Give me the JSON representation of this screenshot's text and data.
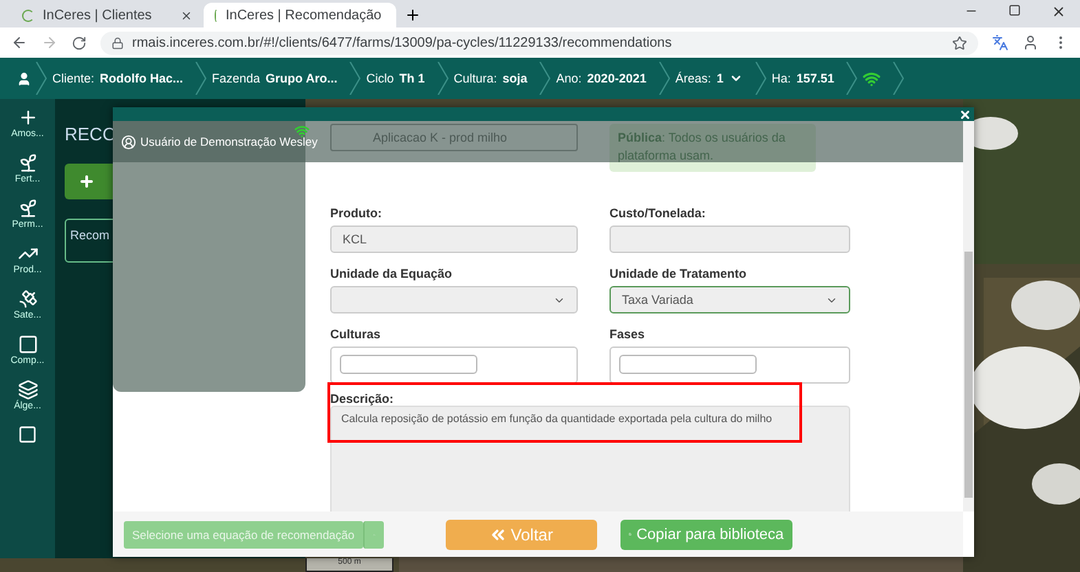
{
  "browser": {
    "tabs": [
      {
        "title": "InCeres | Clientes",
        "selected": false
      },
      {
        "title": "InCeres | Recomendação",
        "selected": true
      }
    ],
    "url": "rmais.inceres.com.br/#!/clients/6477/farms/13009/pa-cycles/11229133/recommendations"
  },
  "nav": {
    "items": [
      {
        "label": "Cliente:",
        "value": "Rodolfo Hac...",
        "kind": "text"
      },
      {
        "label": "Fazenda",
        "value": "Grupo Aro...",
        "kind": "text"
      },
      {
        "label": "Ciclo",
        "value": "Th 1",
        "kind": "text"
      },
      {
        "label": "Cultura:",
        "value": "soja",
        "kind": "text"
      },
      {
        "label": "Ano:",
        "value": "2020-2021",
        "kind": "text"
      },
      {
        "label": "Áreas:",
        "value": "1",
        "kind": "dropdown"
      },
      {
        "label": "Ha:",
        "value": "157.51",
        "kind": "text"
      }
    ]
  },
  "sidebar": {
    "items": [
      {
        "label": "Amos..."
      },
      {
        "label": "Fert..."
      },
      {
        "label": "Perm..."
      },
      {
        "label": "Prod..."
      },
      {
        "label": "Sate..."
      },
      {
        "label": "Comp..."
      },
      {
        "label": "Álge..."
      }
    ]
  },
  "panel": {
    "title": "RECO",
    "card": "Recom"
  },
  "map": {
    "scale": "500 m"
  },
  "modal": {
    "user_menu": "Usuário de Demonstração Wesley",
    "name_value": "Aplicacao K - prod milho",
    "alert": {
      "label": "Pública",
      "text": ": Todos os usuários da plataforma usam."
    },
    "fields": [
      {
        "label": "Produto:",
        "kind": "text",
        "value": "KCL",
        "focused": false
      },
      {
        "label": "Custo/Tonelada:",
        "kind": "text",
        "focused": false
      },
      {
        "label": "Unidade da Equação",
        "kind": "select",
        "focused": false
      },
      {
        "label": "Unidade de Tratamento",
        "kind": "select",
        "value": "Taxa Variada",
        "focused": true
      },
      {
        "label": "Culturas",
        "kind": "tags",
        "focused": false
      },
      {
        "label": "Fases",
        "kind": "tags",
        "focused": false
      }
    ],
    "description": {
      "label": "Descrição:",
      "value": "Calcula reposição de potássio em função da quantidade exportada pela cultura do milho",
      "highlighted": true
    },
    "footer": {
      "equation_button": "Selecione uma equação de recomendação",
      "back_button": "Voltar",
      "copy_button": "Copiar para biblioteca"
    }
  }
}
